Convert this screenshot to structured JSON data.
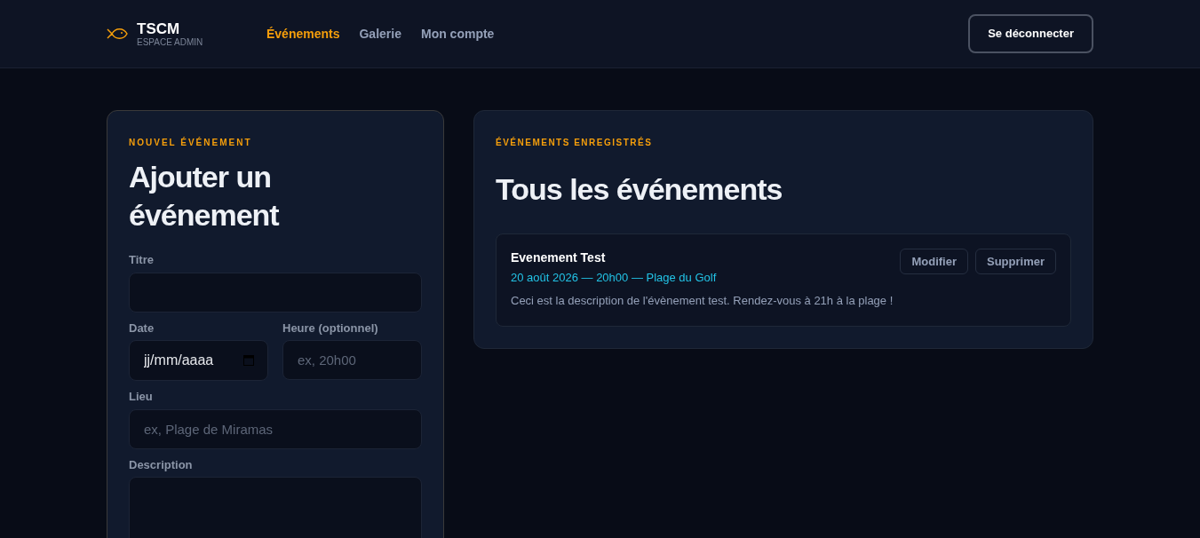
{
  "brand": {
    "name": "TSCM",
    "subtitle": "ESPACE ADMIN"
  },
  "nav": [
    {
      "label": "Événements",
      "selected": true
    },
    {
      "label": "Galerie",
      "selected": false
    },
    {
      "label": "Mon compte",
      "selected": false
    }
  ],
  "logout_button": "Se déconnecter",
  "form_card": {
    "eyebrow": "NOUVEL ÉVÉNEMENT",
    "title": "Ajouter un événement",
    "fields": [
      {
        "label": "Titre",
        "kind": "text"
      },
      {
        "label": "Date",
        "kind": "date",
        "placeholder": "jj/mm/aaaa"
      },
      {
        "label": "Heure (optionnel)",
        "kind": "text",
        "placeholder": "ex, 20h00"
      },
      {
        "label": "Lieu",
        "kind": "text",
        "placeholder": "ex, Plage de Miramas"
      },
      {
        "label": "Description",
        "kind": "textarea"
      }
    ]
  },
  "list_card": {
    "eyebrow": "ÉVÉNEMENTS ENREGISTRÉS",
    "title": "Tous les événements",
    "events": [
      {
        "title": "Evenement Test",
        "meta": "20 août 2026 — 20h00 — Plage du Golf",
        "description": "Ceci est la description de l'évènement test. Rendez-vous à 21h à la plage !",
        "actions": [
          "Modifier",
          "Supprimer"
        ]
      }
    ]
  }
}
